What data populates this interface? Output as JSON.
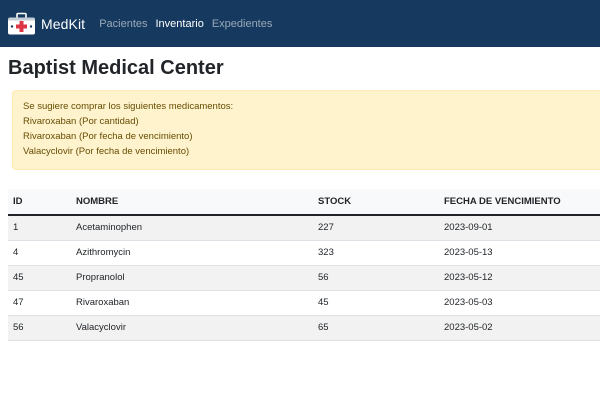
{
  "navbar": {
    "brand": "MedKit",
    "links": [
      {
        "label": "Pacientes",
        "active": false
      },
      {
        "label": "Inventario",
        "active": true
      },
      {
        "label": "Expedientes",
        "active": false
      }
    ]
  },
  "page": {
    "title": "Baptist Medical Center"
  },
  "alert": {
    "lines": [
      "Se sugiere comprar los siguientes medicamentos:",
      "Rivaroxaban (Por cantidad)",
      "Rivaroxaban (Por fecha de vencimiento)",
      "Valacyclovir (Por fecha de vencimiento)"
    ]
  },
  "table": {
    "headers": [
      "ID",
      "NOMBRE",
      "STOCK",
      "FECHA DE VENCIMIENTO"
    ],
    "rows": [
      [
        "1",
        "Acetaminophen",
        "227",
        "2023-09-01"
      ],
      [
        "4",
        "Azithromycin",
        "323",
        "2023-05-13"
      ],
      [
        "45",
        "Propranolol",
        "56",
        "2023-05-12"
      ],
      [
        "47",
        "Rivaroxaban",
        "45",
        "2023-05-03"
      ],
      [
        "56",
        "Valacyclovir",
        "65",
        "2023-05-02"
      ]
    ]
  },
  "colors": {
    "navbar_bg": "#163a5f",
    "alert_bg": "#fff3cd",
    "alert_text": "#664d03",
    "icon_red": "#dc3545"
  },
  "icons": {
    "brand": "medical-kit-icon"
  }
}
